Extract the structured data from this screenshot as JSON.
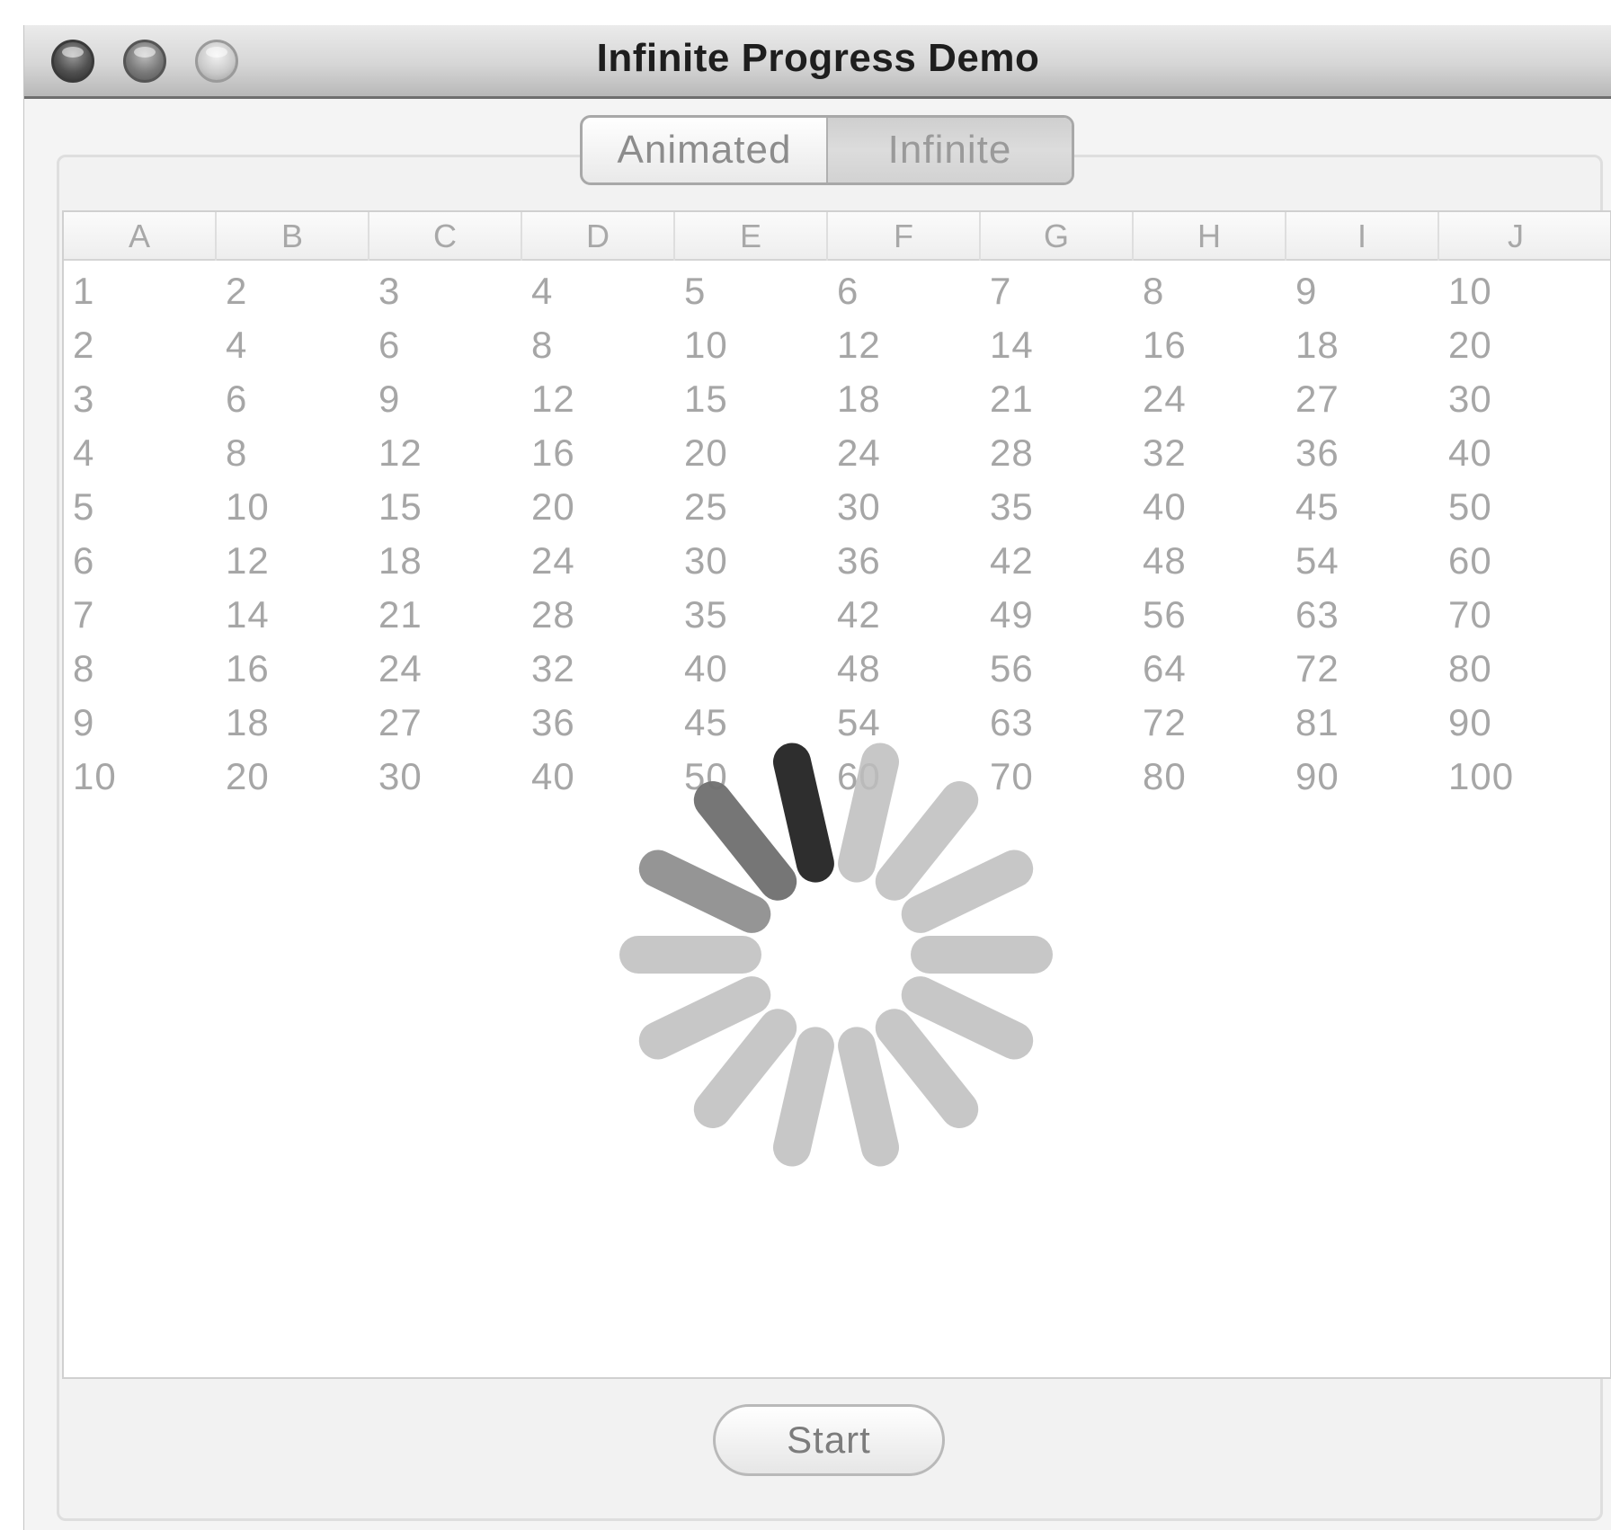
{
  "window": {
    "title": "Infinite Progress Demo",
    "controls": [
      "close-button",
      "minimize-button",
      "zoom-button"
    ]
  },
  "tabs": [
    {
      "label": "Animated",
      "selected": false
    },
    {
      "label": "Infinite",
      "selected": true
    }
  ],
  "table": {
    "columns": [
      "A",
      "B",
      "C",
      "D",
      "E",
      "F",
      "G",
      "H",
      "I",
      "J"
    ],
    "rows": [
      [
        "1",
        "2",
        "3",
        "4",
        "5",
        "6",
        "7",
        "8",
        "9",
        "10"
      ],
      [
        "2",
        "4",
        "6",
        "8",
        "10",
        "12",
        "14",
        "16",
        "18",
        "20"
      ],
      [
        "3",
        "6",
        "9",
        "12",
        "15",
        "18",
        "21",
        "24",
        "27",
        "30"
      ],
      [
        "4",
        "8",
        "12",
        "16",
        "20",
        "24",
        "28",
        "32",
        "36",
        "40"
      ],
      [
        "5",
        "10",
        "15",
        "20",
        "25",
        "30",
        "35",
        "40",
        "45",
        "50"
      ],
      [
        "6",
        "12",
        "18",
        "24",
        "30",
        "36",
        "42",
        "48",
        "54",
        "60"
      ],
      [
        "7",
        "14",
        "21",
        "28",
        "35",
        "42",
        "49",
        "56",
        "63",
        "70"
      ],
      [
        "8",
        "16",
        "24",
        "32",
        "40",
        "48",
        "56",
        "64",
        "72",
        "80"
      ],
      [
        "9",
        "18",
        "27",
        "36",
        "45",
        "54",
        "63",
        "72",
        "81",
        "90"
      ],
      [
        "10",
        "20",
        "30",
        "40",
        "50",
        "60",
        "70",
        "80",
        "90",
        "100"
      ]
    ]
  },
  "spinner": {
    "bars": 14,
    "active_index": 10,
    "colors": {
      "idle": "#bdbdbd",
      "trail1": "#8a8a8a",
      "trail2": "#6f6f6f",
      "active": "#2e2e2e"
    }
  },
  "buttons": {
    "start_label": "Start"
  }
}
